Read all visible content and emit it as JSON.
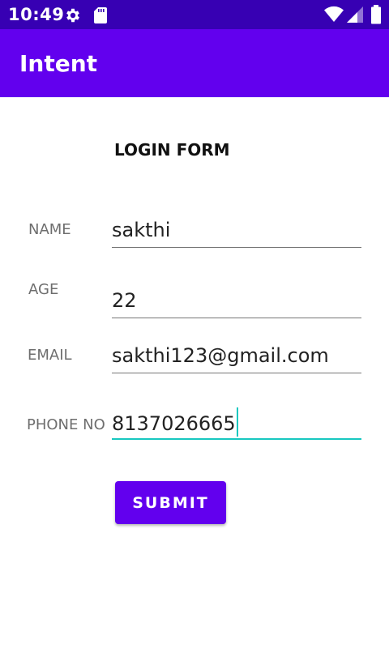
{
  "status_bar": {
    "time": "10:49",
    "icons": [
      "gear-icon",
      "sd-card-icon",
      "wifi-icon",
      "signal-icon",
      "battery-icon"
    ]
  },
  "app_bar": {
    "title": "Intent"
  },
  "form": {
    "title": "LOGIN FORM",
    "fields": [
      {
        "label": "NAME",
        "value": "sakthi"
      },
      {
        "label": "AGE",
        "value": "22"
      },
      {
        "label": "EMAIL",
        "value": "sakthi123@gmail.com"
      },
      {
        "label": "PHONE NO",
        "value": "8137026665"
      }
    ],
    "submit_label": "SUBMIT"
  },
  "colors": {
    "status_bar": "#3700b3",
    "primary": "#6200ee",
    "focus_accent": "#18c8c0"
  }
}
